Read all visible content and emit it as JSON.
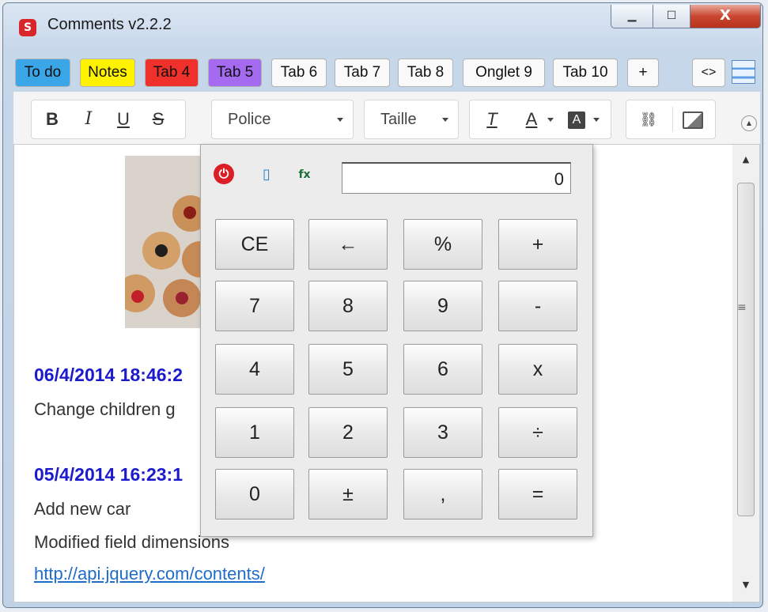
{
  "window": {
    "title": "Comments v2.2.2",
    "app_icon": "sketchup-icon",
    "controls": {
      "minimize": "▁",
      "maximize": "☐",
      "close": "X"
    }
  },
  "tabs": [
    {
      "label": "To do",
      "color": "#3aa6e8"
    },
    {
      "label": "Notes",
      "color": "#fff200"
    },
    {
      "label": "Tab 4",
      "color": "#f0302a"
    },
    {
      "label": "Tab 5",
      "color": "#a46bf0"
    },
    {
      "label": "Tab 6",
      "color": "#f9f9f9"
    },
    {
      "label": "Tab 7",
      "color": "#f9f9f9"
    },
    {
      "label": "Tab 8",
      "color": "#f9f9f9"
    },
    {
      "label": "Onglet 9",
      "color": "#f9f9f9"
    },
    {
      "label": "Tab 10",
      "color": "#f9f9f9"
    }
  ],
  "tab_add_label": "+",
  "tab_code_label": "<>",
  "toolbar": {
    "bold": "B",
    "italic": "I",
    "underline": "U",
    "strike": "S",
    "font_label": "Police",
    "size_label": "Taille",
    "clear_format": "T",
    "text_color": "A",
    "bg_color": "A"
  },
  "entries": [
    {
      "timestamp": "06/4/2014 18:46:2",
      "lines": [
        "Change children g"
      ]
    },
    {
      "timestamp": "05/4/2014 16:23:1",
      "lines": [
        "Add new car",
        "Modified field dimensions"
      ]
    }
  ],
  "link": "http://api.jquery.com/contents/",
  "calculator": {
    "display": "0",
    "keys": [
      [
        "CE",
        "←",
        "%",
        "+"
      ],
      [
        "7",
        "8",
        "9",
        "-"
      ],
      [
        "4",
        "5",
        "6",
        "x"
      ],
      [
        "1",
        "2",
        "3",
        "÷"
      ],
      [
        "0",
        "±",
        ",",
        "="
      ]
    ]
  }
}
